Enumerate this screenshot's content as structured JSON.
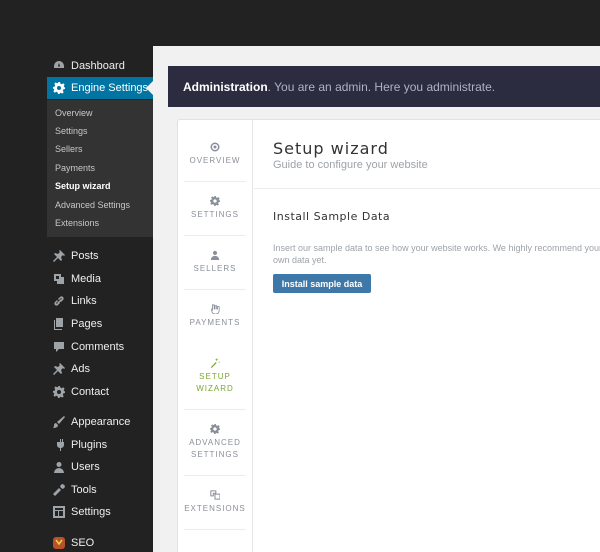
{
  "sidebar": {
    "items": [
      {
        "label": "Dashboard",
        "icon": "dashboard-icon"
      },
      {
        "label": "Engine Settings",
        "icon": "gear-icon",
        "active": true
      },
      {
        "label": "Posts",
        "icon": "pin-icon"
      },
      {
        "label": "Media",
        "icon": "media-icon"
      },
      {
        "label": "Links",
        "icon": "link-icon"
      },
      {
        "label": "Pages",
        "icon": "pages-icon"
      },
      {
        "label": "Comments",
        "icon": "comment-icon"
      },
      {
        "label": "Ads",
        "icon": "pin-icon"
      },
      {
        "label": "Contact",
        "icon": "gear-icon"
      },
      {
        "label": "Appearance",
        "icon": "brush-icon"
      },
      {
        "label": "Plugins",
        "icon": "plug-icon"
      },
      {
        "label": "Users",
        "icon": "user-icon"
      },
      {
        "label": "Tools",
        "icon": "wrench-icon"
      },
      {
        "label": "Settings",
        "icon": "settings-icon"
      },
      {
        "label": "SEO",
        "icon": "seo-icon"
      }
    ],
    "submenu": [
      {
        "label": "Overview"
      },
      {
        "label": "Settings"
      },
      {
        "label": "Sellers"
      },
      {
        "label": "Payments"
      },
      {
        "label": "Setup wizard",
        "current": true
      },
      {
        "label": "Advanced Settings"
      },
      {
        "label": "Extensions"
      }
    ]
  },
  "admin_bar": {
    "bold": "Administration",
    "rest": ". You are an admin. Here you administrate."
  },
  "tabs": [
    {
      "line1": "OVERVIEW",
      "line2": "",
      "icon": "target-icon"
    },
    {
      "line1": "SETTINGS",
      "line2": "",
      "icon": "gear-icon"
    },
    {
      "line1": "SELLERS",
      "line2": "",
      "icon": "user-icon"
    },
    {
      "line1": "PAYMENTS",
      "line2": "",
      "icon": "hand-icon"
    },
    {
      "line1": "SETUP",
      "line2": "WIZARD",
      "icon": "wand-icon",
      "active": true
    },
    {
      "line1": "ADVANCED",
      "line2": "SETTINGS",
      "icon": "gear-icon"
    },
    {
      "line1": "EXTENSIONS",
      "line2": "",
      "icon": "extensions-icon"
    }
  ],
  "main": {
    "title": "Setup wizard",
    "subtitle": "Guide to configure your website",
    "section_title": "Install Sample Data",
    "description": "Insert our sample data to see how your website works. We highly recommend your own data yet.",
    "button_label": "Install sample data"
  },
  "colors": {
    "sidebar_bg": "#222222",
    "active_menu": "#0074a2",
    "admin_bar": "#2b2c3f",
    "active_tab": "#7aa831",
    "button": "#3d78a8"
  }
}
